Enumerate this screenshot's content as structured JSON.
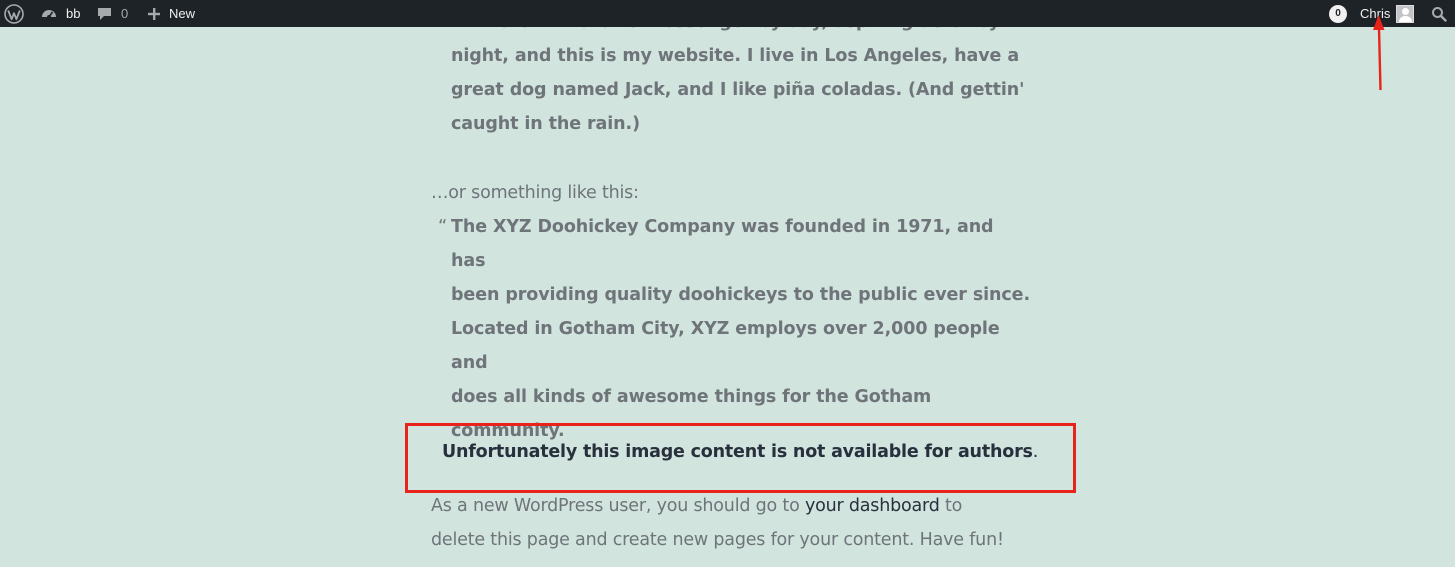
{
  "adminbar": {
    "site_name": "bb",
    "comments_count": "0",
    "new_label": "New",
    "notification_count": "0",
    "user_name": "Chris"
  },
  "content": {
    "quote1_lines": [
      "Hi there! I'm a bike messenger by day, aspiring actor by",
      "night, and this is my website. I live in Los Angeles, have a",
      "great dog named Jack, and I like piña coladas. (And gettin'",
      "caught in the rain.)"
    ],
    "intro2": "…or something like this:",
    "quote2_mark": "“",
    "quote2_lines": [
      "The XYZ Doohickey Company was founded in 1971, and has",
      "been providing quality doohickeys to the public ever since.",
      "Located in Gotham City, XYZ employs over 2,000 people and",
      "does all kinds of awesome things for the Gotham",
      "community."
    ],
    "notice": "Unfortunately this image content is not available for authors",
    "notice_period": ".",
    "bottom_before_link": "As a new WordPress user, you should go to ",
    "dashboard_link": "your dashboard",
    "bottom_after_link": " to",
    "bottom_line2": "delete this page and create new pages for your content. Have fun!"
  },
  "colors": {
    "background": "#d1e4dd",
    "adminbar": "#1d2327",
    "text_muted": "#6e7479",
    "text_dark": "#28303d",
    "annotation_red": "#e8231c"
  }
}
